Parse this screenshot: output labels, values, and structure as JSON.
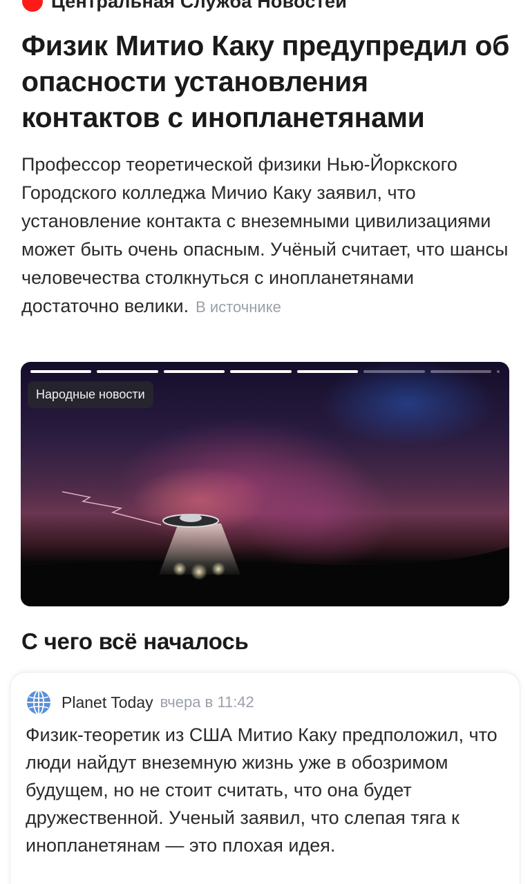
{
  "source": {
    "name": "Центральная Служба Новостей",
    "dot_color": "#ff1a1a"
  },
  "article": {
    "headline": "Физик Митио Каку предупредил об опасности установления контактов с инопланетянами",
    "summary": "Профессор теоретической физики Нью-Йоркского Городского колледжа Мичио Каку заявил, что установление контакта с внеземными цивилизациями может быть очень опасным. Учёный считает, что шансы человечества столкнуться с инопланетянами достаточно велики.",
    "source_link": "В источнике"
  },
  "story": {
    "badge": "Народные новости",
    "segments_total": 8,
    "segments_viewed": 5
  },
  "section": {
    "title": "С чего всё началось"
  },
  "card": {
    "source": "Planet Today",
    "time": "вчера в 11:42",
    "text": "Физик-теоретик из США Митио Каку предположил, что люди найдут внеземную жизнь уже в обозримом будущем, но не стоит считать, что она будет дружественной. Ученый заявил, что слепая тяга к инопланетянам — это плохая идея.",
    "icon": "globe-icon"
  }
}
